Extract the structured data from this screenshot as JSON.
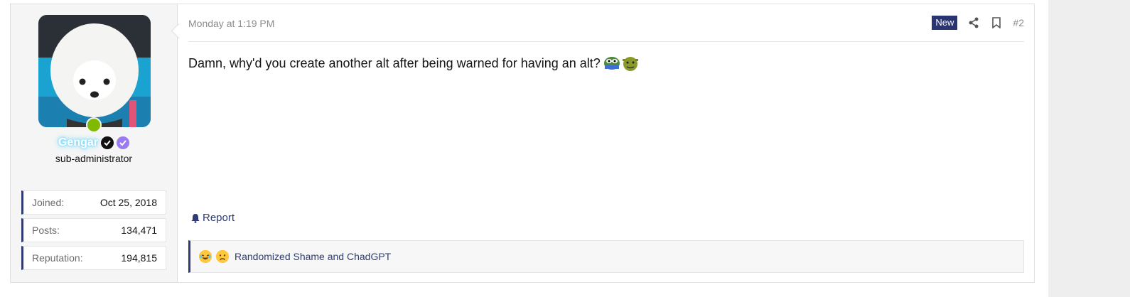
{
  "post": {
    "date": "Monday at 1:19 PM",
    "new_label": "New",
    "post_number": "#2",
    "message": "Damn, why'd you create another alt after being warned for having an alt?",
    "report_label": "Report",
    "reactions_text": "Randomized Shame and ChadGPT"
  },
  "user": {
    "name": "Gengar",
    "title": "sub-administrator",
    "stats": [
      {
        "label": "Joined:",
        "value": "Oct 25, 2018"
      },
      {
        "label": "Posts:",
        "value": "134,471"
      },
      {
        "label": "Reputation:",
        "value": "194,815"
      }
    ]
  },
  "colors": {
    "accent": "#2f3b73",
    "new_badge": "#2a3470",
    "online": "#7fba00"
  },
  "icons": [
    "share-icon",
    "bookmark-icon",
    "bell-icon",
    "verified-black-icon",
    "verified-purple-icon",
    "laughing-emoji-icon",
    "sad-emoji-icon"
  ]
}
